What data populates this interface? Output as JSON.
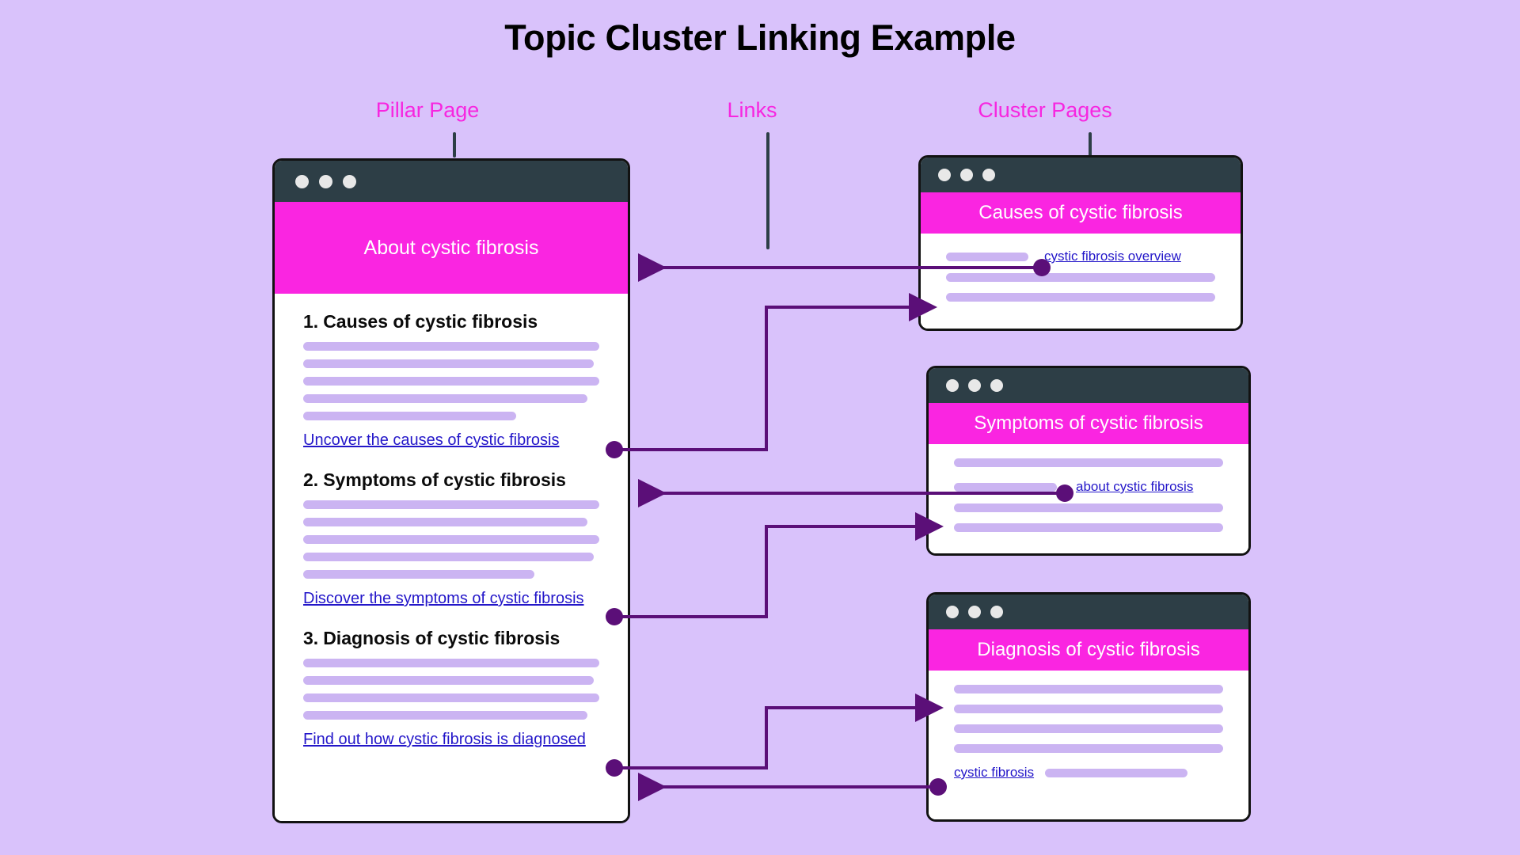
{
  "title": "Topic Cluster Linking Example",
  "colors": {
    "background": "#d9c2fb",
    "accent_pink": "#f726e0",
    "banner_pink": "#fa25e1",
    "titlebar_dark": "#2d3e46",
    "skeleton_purple": "#cbb4f2",
    "link_blue": "#2316c9",
    "connector_purple": "#5b0f78"
  },
  "labels": {
    "pillar": "Pillar Page",
    "links": "Links",
    "cluster": "Cluster Pages"
  },
  "pillar_page": {
    "banner_title": "About cystic fibrosis",
    "sections": [
      {
        "number": "1.",
        "heading": "Causes of cystic fibrosis",
        "skeleton_widths": [
          "100%",
          "98%",
          "100%",
          "96%",
          "72%"
        ],
        "link_text": "Uncover the causes of cystic fibrosis"
      },
      {
        "number": "2.",
        "heading": "Symptoms of cystic fibrosis",
        "skeleton_widths": [
          "100%",
          "96%",
          "100%",
          "98%",
          "78%"
        ],
        "link_text": "Discover the symptoms of cystic fibrosis"
      },
      {
        "number": "3.",
        "heading": "Diagnosis of cystic fibrosis",
        "skeleton_widths": [
          "100%",
          "98%",
          "100%",
          "96%"
        ],
        "link_text": "Find out how cystic fibrosis is diagnosed"
      }
    ]
  },
  "cluster_pages": [
    {
      "banner_title": "Causes of cystic fibrosis",
      "link_text": "cystic fibrosis overview",
      "link_position": "right",
      "rows": [
        "link",
        "100%",
        "100%"
      ]
    },
    {
      "banner_title": "Symptoms of cystic fibrosis",
      "link_text": "about cystic fibrosis",
      "link_position": "right",
      "rows": [
        "100%",
        "link",
        "100%",
        "100%"
      ]
    },
    {
      "banner_title": "Diagnosis of cystic fibrosis",
      "link_text": "cystic fibrosis",
      "link_position": "left",
      "rows": [
        "100%",
        "100%",
        "100%",
        "100%",
        "link"
      ]
    }
  ]
}
